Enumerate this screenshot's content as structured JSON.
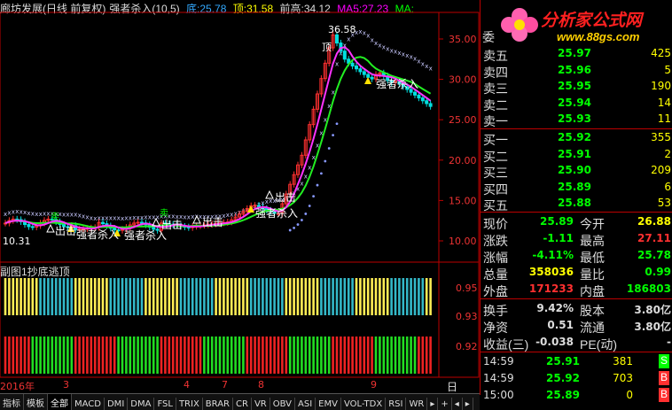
{
  "header": {
    "stock": "廊坊发展(日线 前复权)",
    "indicator": "强者杀入(10,5)",
    "low_label": "底:",
    "low_value": "25.78",
    "top_label": "顶:",
    "top_value": "31.58",
    "prev_high_label": "前高:",
    "prev_high_value": "34.12",
    "ma5_label": "MA5:",
    "ma5_value": "27.23",
    "ma_label": "MA:"
  },
  "chart_labels": {
    "peak_price": "36.58",
    "low_price": "10.31",
    "buy_sell_1": "强者杀入",
    "buy_sell_2": "强者杀入",
    "buy_sell_3": "强者杀入",
    "buy_sell_4": "强者杀入",
    "exit_1": "出击",
    "exit_2": "出击",
    "exit_3": "出击",
    "exit_4": "出击",
    "top_mark": "顶",
    "sell_mark": "卖",
    "sell_mark2": "卖"
  },
  "price_axis": [
    "35.00",
    "30.00",
    "25.00",
    "20.00",
    "15.00",
    "10.00"
  ],
  "sub_chart": {
    "title": "副图1抄底逃顶",
    "axis": [
      "0.95",
      "0.93",
      "0.92"
    ]
  },
  "date_axis": {
    "year": "2016年",
    "months": [
      "3",
      "4",
      "7",
      "8",
      "9"
    ],
    "period": "日线"
  },
  "tabs": [
    "指标",
    "模板",
    "全部",
    "MACD",
    "DMI",
    "DMA",
    "FSL",
    "TRIX",
    "BRAR",
    "CR",
    "VR",
    "OBV",
    "ASI",
    "EMV",
    "VOL-TDX",
    "RSI",
    "WR"
  ],
  "tab_arrows": [
    "▸",
    "+",
    "◂",
    "▸"
  ],
  "logo": {
    "name": "分析家公式网",
    "url": "www.88gs.com"
  },
  "order_book": {
    "ratio_label": "委",
    "sells": [
      {
        "label": "卖五",
        "price": "25.97",
        "vol": "425"
      },
      {
        "label": "卖四",
        "price": "25.96",
        "vol": "5"
      },
      {
        "label": "卖三",
        "price": "25.95",
        "vol": "190"
      },
      {
        "label": "卖二",
        "price": "25.94",
        "vol": "14"
      },
      {
        "label": "卖一",
        "price": "25.93",
        "vol": "11"
      }
    ],
    "buys": [
      {
        "label": "买一",
        "price": "25.92",
        "vol": "355"
      },
      {
        "label": "买二",
        "price": "25.91",
        "vol": "2"
      },
      {
        "label": "买三",
        "price": "25.90",
        "vol": "209"
      },
      {
        "label": "买四",
        "price": "25.89",
        "vol": "6"
      },
      {
        "label": "买五",
        "price": "25.88",
        "vol": "53"
      }
    ]
  },
  "quote": {
    "rows": [
      {
        "l1": "现价",
        "v1": "25.89",
        "c1": "#00ff00",
        "l2": "今开",
        "v2": "26.88",
        "c2": "#ffff00"
      },
      {
        "l1": "涨跌",
        "v1": "-1.11",
        "c1": "#00ff00",
        "l2": "最高",
        "v2": "27.11",
        "c2": "#ff3030"
      },
      {
        "l1": "涨幅",
        "v1": "-4.11%",
        "c1": "#00ff00",
        "l2": "最低",
        "v2": "25.78",
        "c2": "#00ff00"
      },
      {
        "l1": "总量",
        "v1": "358036",
        "c1": "#ffff00",
        "l2": "量比",
        "v2": "0.99",
        "c2": "#00ff00"
      },
      {
        "l1": "外盘",
        "v1": "171233",
        "c1": "#ff3030",
        "l2": "内盘",
        "v2": "186803",
        "c2": "#00ff00"
      }
    ],
    "rows2": [
      {
        "l1": "换手",
        "v1": "9.42%",
        "c1": "#dddddd",
        "l2": "股本",
        "v2": "3.80亿",
        "c2": "#dddddd"
      },
      {
        "l1": "净资",
        "v1": "0.51",
        "c1": "#dddddd",
        "l2": "流通",
        "v2": "3.80亿",
        "c2": "#dddddd"
      },
      {
        "l1": "收益(三)",
        "v1": "-0.038",
        "c1": "#dddddd",
        "l2": "PE(动)",
        "v2": "-",
        "c2": "#dddddd"
      }
    ]
  },
  "ticks": [
    {
      "time": "14:59",
      "price": "25.91",
      "vol": "381",
      "side": "S",
      "pc": "#00ff00",
      "sc": "#00ff00"
    },
    {
      "time": "14:59",
      "price": "25.92",
      "vol": "703",
      "side": "B",
      "pc": "#00ff00",
      "sc": "#ff3030"
    },
    {
      "time": "15:00",
      "price": "25.89",
      "vol": "0",
      "side": "B",
      "pc": "#00ff00",
      "sc": "#ff3030"
    }
  ]
}
